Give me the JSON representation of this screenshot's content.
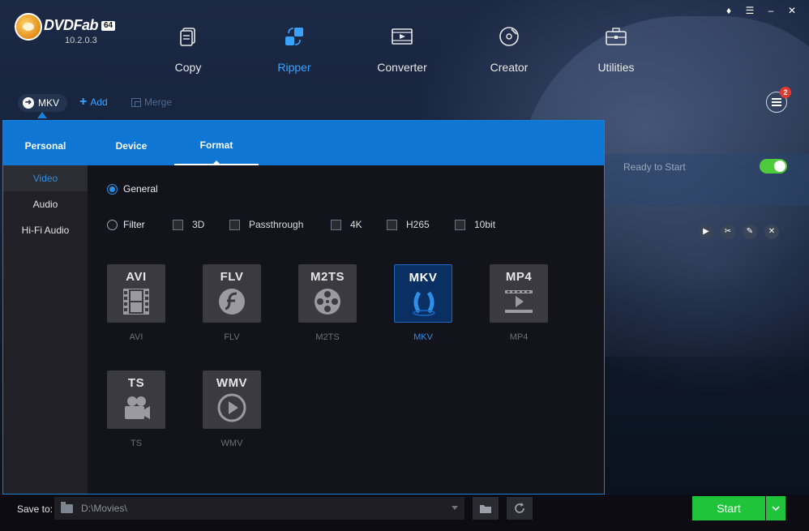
{
  "app": {
    "name": "DVDFab",
    "bits_badge": "64",
    "version": "10.2.0.3"
  },
  "modules": [
    {
      "label": "Copy",
      "icon": "copy-icon"
    },
    {
      "label": "Ripper",
      "icon": "ripper-icon"
    },
    {
      "label": "Converter",
      "icon": "converter-icon"
    },
    {
      "label": "Creator",
      "icon": "creator-icon"
    },
    {
      "label": "Utilities",
      "icon": "utilities-icon"
    }
  ],
  "active_module": "Ripper",
  "window_controls": [
    "pin-icon",
    "menu-icon",
    "minimize-icon",
    "close-icon"
  ],
  "toolbar": {
    "profile_label": "MKV",
    "add_label": "Add",
    "merge_label": "Merge",
    "task_count": "2"
  },
  "task": {
    "status_text": "Ready to Start",
    "toggle_on": true,
    "actions": [
      "play-icon",
      "trim-icon",
      "edit-icon",
      "remove-icon"
    ]
  },
  "panel": {
    "tabs": [
      "Personal",
      "Device",
      "Format"
    ],
    "active_tab": "Format",
    "categories": [
      "Video",
      "Audio",
      "Hi-Fi Audio"
    ],
    "active_category": "Video",
    "general_label": "General",
    "filter_label": "Filter",
    "general_selected": true,
    "filter_options": [
      "3D",
      "Passthrough",
      "4K",
      "H265",
      "10bit"
    ],
    "formats": [
      {
        "code": "AVI",
        "label": "AVI",
        "icon": "film-strip-icon"
      },
      {
        "code": "FLV",
        "label": "FLV",
        "icon": "flash-icon"
      },
      {
        "code": "M2TS",
        "label": "M2TS",
        "icon": "film-reel-icon"
      },
      {
        "code": "MKV",
        "label": "MKV",
        "icon": "mkv-logo-icon"
      },
      {
        "code": "MP4",
        "label": "MP4",
        "icon": "video-play-icon"
      },
      {
        "code": "TS",
        "label": "TS",
        "icon": "camera-icon"
      },
      {
        "code": "WMV",
        "label": "WMV",
        "icon": "play-circle-icon"
      }
    ],
    "selected_format": "MKV"
  },
  "bottom": {
    "save_to_label": "Save to:",
    "save_path": "D:\\Movies\\",
    "start_label": "Start"
  },
  "colors": {
    "accent_blue": "#0f76d3",
    "selected_text": "#2d8fe6",
    "start_green": "#20c43a",
    "toggle_green": "#4ecb3a",
    "badge_red": "#e23a2e"
  }
}
